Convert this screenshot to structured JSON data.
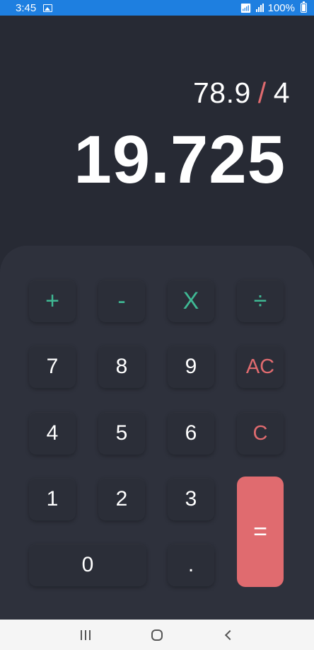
{
  "status_bar": {
    "time": "3:45",
    "battery": "100%",
    "icons": [
      "image-icon",
      "wifi-icon",
      "signal-icon",
      "battery-icon"
    ]
  },
  "display": {
    "operand1": "78.9",
    "operator": "/",
    "operand2": "4",
    "result": "19.725"
  },
  "keypad": {
    "add": "+",
    "subtract": "-",
    "multiply": "X",
    "divide": "÷",
    "seven": "7",
    "eight": "8",
    "nine": "9",
    "all_clear": "AC",
    "four": "4",
    "five": "5",
    "six": "6",
    "clear": "C",
    "one": "1",
    "two": "2",
    "three": "3",
    "equals": "=",
    "zero": "0",
    "decimal": "."
  },
  "colors": {
    "background": "#272a34",
    "panel": "#2e313c",
    "operator_green": "#3fb994",
    "accent_red": "#e06b6f",
    "status_bar": "#1e7fe0"
  },
  "nav_bar": {
    "icons": [
      "recent-apps-icon",
      "home-icon",
      "back-icon"
    ]
  }
}
